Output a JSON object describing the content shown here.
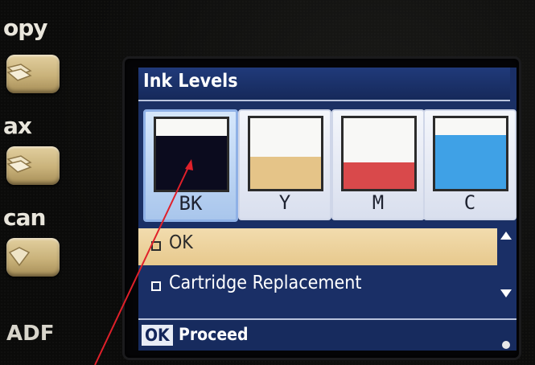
{
  "side_panel": {
    "labels": [
      "opy",
      "ax",
      "can"
    ],
    "adf_label": "ADF"
  },
  "screen": {
    "title": "Ink Levels",
    "cartridges": [
      {
        "code": "BK",
        "color": "#0b0b1e",
        "level": 0.76,
        "selected": true
      },
      {
        "code": "Y",
        "color": "#e5c488",
        "level": 0.45,
        "selected": false
      },
      {
        "code": "M",
        "color": "#d9494b",
        "level": 0.38,
        "selected": false
      },
      {
        "code": "C",
        "color": "#3fa1e6",
        "level": 0.76,
        "selected": false
      }
    ],
    "menu_items": [
      {
        "label": "OK",
        "selected": true
      },
      {
        "label": "Cartridge Replacement",
        "selected": false
      }
    ],
    "footer": {
      "key": "OK",
      "action": "Proceed"
    }
  },
  "colors": {
    "lcd_background": "#1a2f66",
    "highlight": "#e7c98d",
    "annotation_arrow": "#e0202a"
  }
}
